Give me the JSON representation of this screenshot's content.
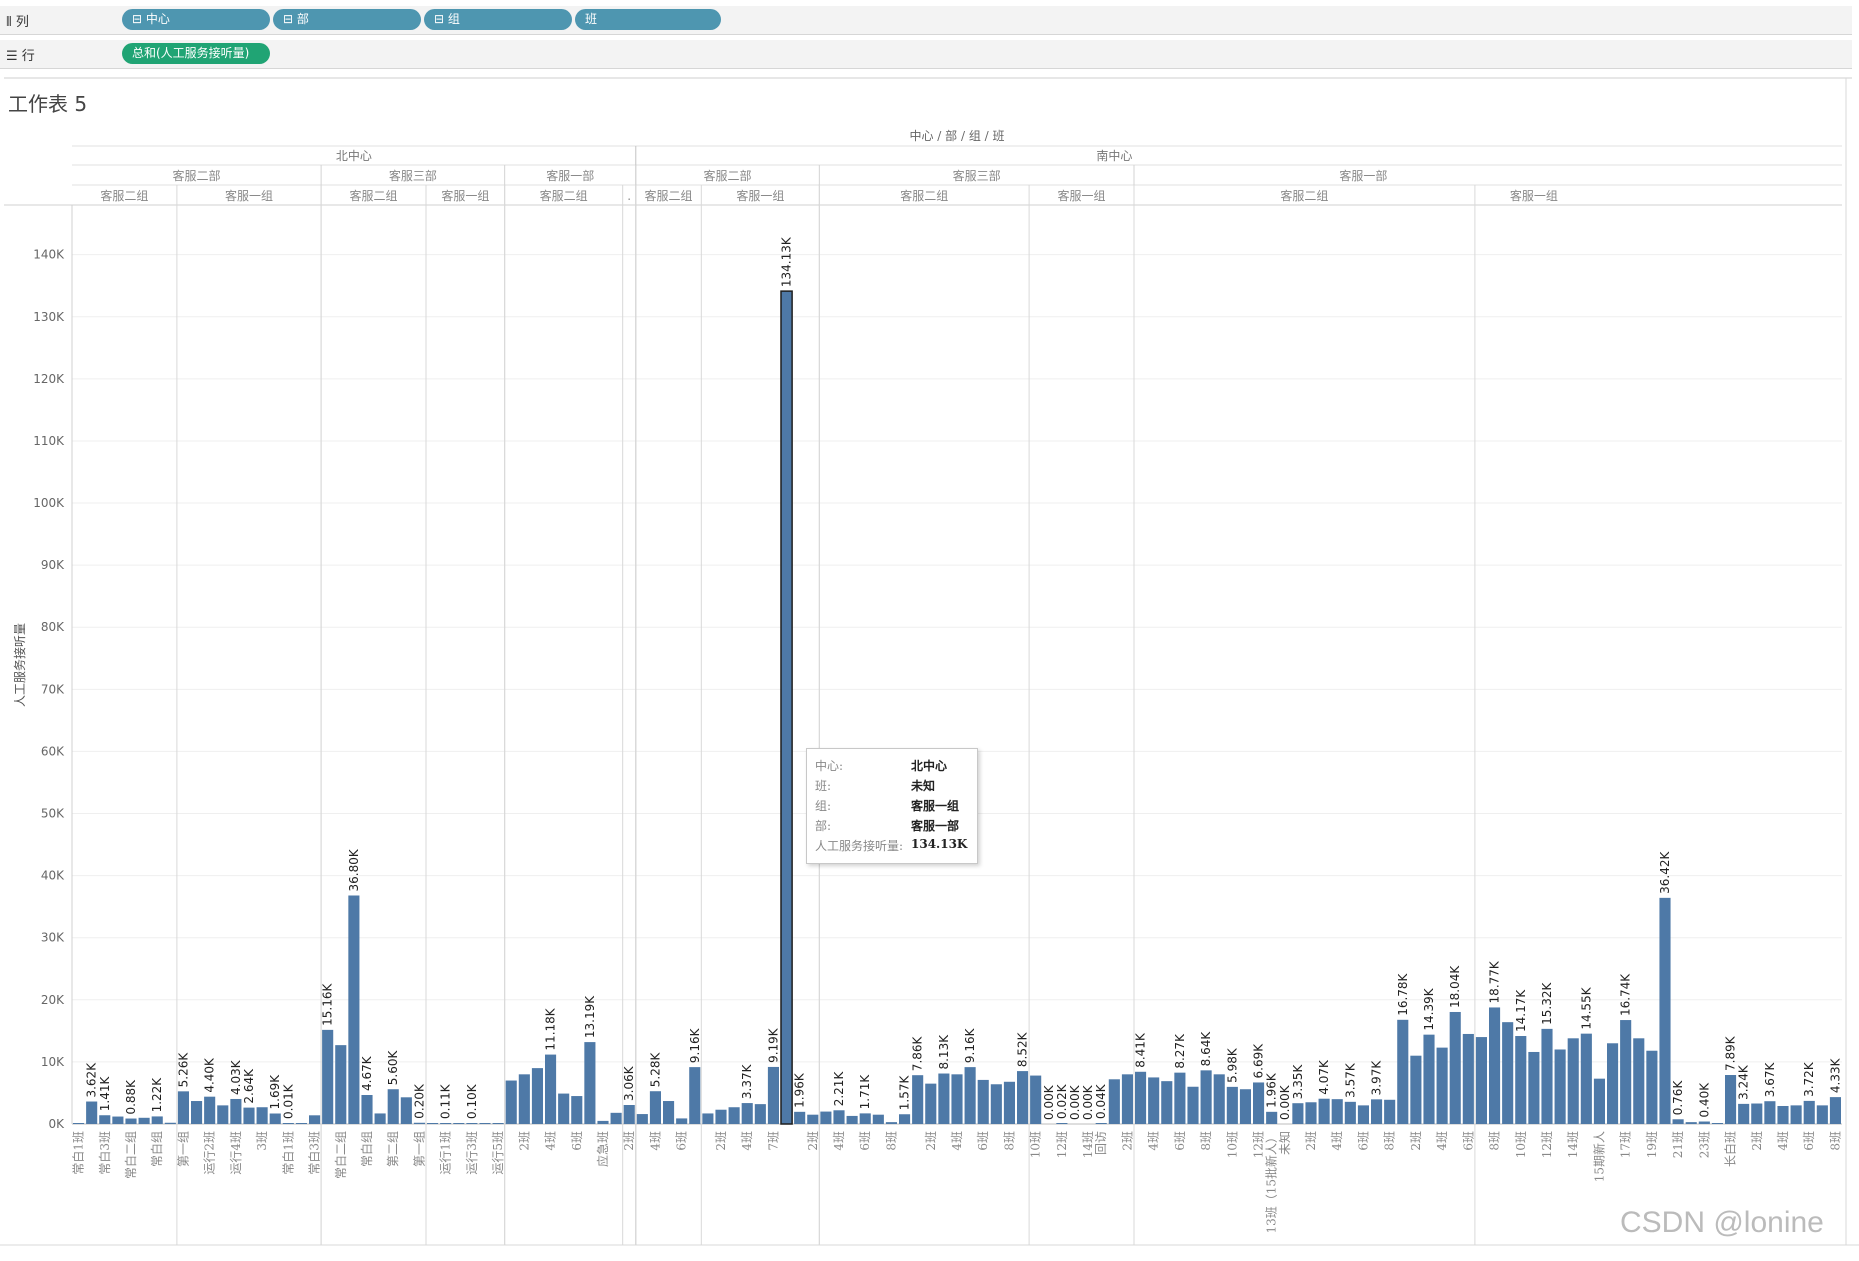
{
  "shelves": {
    "columns_label": "列",
    "columns": [
      "中心",
      "部",
      "组",
      "班"
    ],
    "rows_label": "行",
    "rows": [
      "总和(人工服务接听量)"
    ],
    "collapse_glyph": "⊟"
  },
  "sheet_title": "工作表 5",
  "tooltip": {
    "rows": [
      {
        "key": "中心:",
        "value": "北中心"
      },
      {
        "key": "班:",
        "value": "未知"
      },
      {
        "key": "组:",
        "value": "客服一组"
      },
      {
        "key": "部:",
        "value": "客服一部"
      },
      {
        "key": "人工服务接听量:",
        "value": "134.13K"
      }
    ]
  },
  "watermark": "CSDN @lonine",
  "colors": {
    "bar": "#4e79a7",
    "pill_dim": "#4e96b0",
    "pill_measure": "#20a474"
  },
  "chart_data": {
    "type": "bar",
    "title": "中心 / 部 / 组 / 班",
    "ylabel": "人工服务接听量",
    "ylim": [
      0,
      148000
    ],
    "yticks": [
      0,
      10000,
      20000,
      30000,
      40000,
      50000,
      60000,
      70000,
      80000,
      90000,
      100000,
      110000,
      120000,
      130000,
      140000
    ],
    "ytick_labels": [
      "0K",
      "10K",
      "20K",
      "30K",
      "40K",
      "50K",
      "60K",
      "70K",
      "80K",
      "90K",
      "100K",
      "110K",
      "120K",
      "130K",
      "140K"
    ],
    "headers": {
      "centers": [
        {
          "name": "北中心",
          "span": [
            0,
            43
          ]
        },
        {
          "name": "南中心",
          "span": [
            43,
            116
          ]
        }
      ],
      "departments": [
        {
          "name": "客服二部",
          "span": [
            0,
            19
          ]
        },
        {
          "name": "客服三部",
          "span": [
            19,
            33
          ]
        },
        {
          "name": "客服一部",
          "span": [
            33,
            43
          ]
        },
        {
          "name": "客服二部",
          "span": [
            43,
            57
          ]
        },
        {
          "name": "客服三部",
          "span": [
            57,
            81
          ]
        },
        {
          "name": "客服一部",
          "span": [
            81,
            116
          ]
        }
      ],
      "groups": [
        {
          "name": "客服二组",
          "span": [
            0,
            8
          ]
        },
        {
          "name": "客服一组",
          "span": [
            8,
            19
          ]
        },
        {
          "name": "客服二组",
          "span": [
            19,
            27
          ]
        },
        {
          "name": "客服一组",
          "span": [
            27,
            33
          ]
        },
        {
          "name": "客服二组",
          "span": [
            33,
            42
          ]
        },
        {
          "name": ".",
          "span": [
            42,
            43
          ]
        },
        {
          "name": "客服二组",
          "span": [
            43,
            48
          ]
        },
        {
          "name": "客服一组",
          "span": [
            48,
            57
          ]
        },
        {
          "name": "客服二组",
          "span": [
            57,
            73
          ]
        },
        {
          "name": "客服一组",
          "span": [
            73,
            81
          ]
        },
        {
          "name": "客服二组",
          "span": [
            81,
            107
          ]
        },
        {
          "name": "客服一组",
          "span": [
            107,
            116
          ]
        }
      ]
    },
    "bars": [
      {
        "category": "常白1班",
        "value": 100
      },
      {
        "category": "",
        "value": 3620,
        "label": "3.62K"
      },
      {
        "category": "常白3班",
        "value": 1410,
        "label": "1.41K"
      },
      {
        "category": "",
        "value": 1200
      },
      {
        "category": "常白二组",
        "value": 880,
        "label": "0.88K"
      },
      {
        "category": "",
        "value": 1000
      },
      {
        "category": "常白组",
        "value": 1220,
        "label": "1.22K"
      },
      {
        "category": "",
        "value": 200
      },
      {
        "category": "第一组",
        "value": 5260,
        "label": "5.26K"
      },
      {
        "category": "",
        "value": 3700
      },
      {
        "category": "运行2班",
        "value": 4400,
        "label": "4.40K"
      },
      {
        "category": "",
        "value": 3000
      },
      {
        "category": "运行4班",
        "value": 4030,
        "label": "4.03K"
      },
      {
        "category": "",
        "value": 2640,
        "label": "2.64K"
      },
      {
        "category": "3班",
        "value": 2700
      },
      {
        "category": "",
        "value": 1690,
        "label": "1.69K"
      },
      {
        "category": "常白1班",
        "value": 10,
        "label": "0.01K"
      },
      {
        "category": "",
        "value": 100
      },
      {
        "category": "常白3班",
        "value": 1400
      },
      {
        "category": "",
        "value": 15160,
        "label": "15.16K"
      },
      {
        "category": "常白二组",
        "value": 12700
      },
      {
        "category": "",
        "value": 36800,
        "label": "36.80K"
      },
      {
        "category": "常白组",
        "value": 4670,
        "label": "4.67K"
      },
      {
        "category": "",
        "value": 1700
      },
      {
        "category": "第二组",
        "value": 5600,
        "label": "5.60K"
      },
      {
        "category": "",
        "value": 4300
      },
      {
        "category": "第一组",
        "value": 200,
        "label": "0.20K"
      },
      {
        "category": "",
        "value": 50
      },
      {
        "category": "运行1班",
        "value": 110,
        "label": "0.11K"
      },
      {
        "category": "",
        "value": 50
      },
      {
        "category": "运行3班",
        "value": 100,
        "label": "0.10K"
      },
      {
        "category": "",
        "value": 50
      },
      {
        "category": "运行5班",
        "value": 80
      },
      {
        "category": "",
        "value": 7000
      },
      {
        "category": "2班",
        "value": 8000
      },
      {
        "category": "",
        "value": 9000
      },
      {
        "category": "4班",
        "value": 11180,
        "label": "11.18K"
      },
      {
        "category": "",
        "value": 4900
      },
      {
        "category": "6班",
        "value": 4500
      },
      {
        "category": "",
        "value": 13190,
        "label": "13.19K"
      },
      {
        "category": "应急班",
        "value": 500
      },
      {
        "category": "",
        "value": 1800
      },
      {
        "category": "2班",
        "value": 3060,
        "label": "3.06K"
      },
      {
        "category": "",
        "value": 1600
      },
      {
        "category": "4班",
        "value": 5280,
        "label": "5.28K"
      },
      {
        "category": "",
        "value": 3700
      },
      {
        "category": "6班",
        "value": 900
      },
      {
        "category": "",
        "value": 9160,
        "label": "9.16K"
      },
      {
        "category": "",
        "value": 1700
      },
      {
        "category": "2班",
        "value": 2300
      },
      {
        "category": "",
        "value": 2700
      },
      {
        "category": "4班",
        "value": 3370,
        "label": "3.37K"
      },
      {
        "category": "",
        "value": 3200
      },
      {
        "category": "7班",
        "value": 9190,
        "label": "9.19K"
      },
      {
        "category": "",
        "value": 134130,
        "label": "134.13K"
      },
      {
        "category": "",
        "value": 1960,
        "label": "1.96K"
      },
      {
        "category": "2班",
        "value": 1500
      },
      {
        "category": "",
        "value": 2000
      },
      {
        "category": "4班",
        "value": 2210,
        "label": "2.21K"
      },
      {
        "category": "",
        "value": 1300
      },
      {
        "category": "6班",
        "value": 1710,
        "label": "1.71K"
      },
      {
        "category": "",
        "value": 1500
      },
      {
        "category": "8班",
        "value": 300
      },
      {
        "category": "",
        "value": 1570,
        "label": "1.57K"
      },
      {
        "category": "",
        "value": 7860,
        "label": "7.86K"
      },
      {
        "category": "2班",
        "value": 6500
      },
      {
        "category": "",
        "value": 8130,
        "label": "8.13K"
      },
      {
        "category": "4班",
        "value": 8000
      },
      {
        "category": "",
        "value": 9160,
        "label": "9.16K"
      },
      {
        "category": "6班",
        "value": 7100
      },
      {
        "category": "",
        "value": 6400
      },
      {
        "category": "8班",
        "value": 6800
      },
      {
        "category": "",
        "value": 8520,
        "label": "8.52K"
      },
      {
        "category": "10班",
        "value": 7800
      },
      {
        "category": "",
        "value": 0,
        "label": "0.00K"
      },
      {
        "category": "12班",
        "value": 20,
        "label": "0.02K"
      },
      {
        "category": "",
        "value": 0,
        "label": "0.00K"
      },
      {
        "category": "14班",
        "value": 0,
        "label": "0.00K"
      },
      {
        "category": "回访",
        "value": 40,
        "label": "0.04K"
      },
      {
        "category": "",
        "value": 7200
      },
      {
        "category": "2班",
        "value": 8000
      },
      {
        "category": "",
        "value": 8410,
        "label": "8.41K"
      },
      {
        "category": "4班",
        "value": 7500
      },
      {
        "category": "",
        "value": 6900
      },
      {
        "category": "6班",
        "value": 8270,
        "label": "8.27K"
      },
      {
        "category": "",
        "value": 6000
      },
      {
        "category": "8班",
        "value": 8640,
        "label": "8.64K"
      },
      {
        "category": "",
        "value": 8000
      },
      {
        "category": "10班",
        "value": 5980,
        "label": "5.98K"
      },
      {
        "category": "",
        "value": 5600
      },
      {
        "category": "12班",
        "value": 6690,
        "label": "6.69K"
      },
      {
        "category": "13班（15批新人）",
        "value": 1960,
        "label": "1.96K"
      },
      {
        "category": "未知",
        "value": 0,
        "label": "0.00K"
      },
      {
        "category": "",
        "value": 3350,
        "label": "3.35K"
      },
      {
        "category": "2班",
        "value": 3500
      },
      {
        "category": "",
        "value": 4070,
        "label": "4.07K"
      },
      {
        "category": "4班",
        "value": 4000
      },
      {
        "category": "",
        "value": 3570,
        "label": "3.57K"
      },
      {
        "category": "6班",
        "value": 3000
      },
      {
        "category": "",
        "value": 3970,
        "label": "3.97K"
      },
      {
        "category": "8班",
        "value": 3900
      },
      {
        "category": "",
        "value": 16780,
        "label": "16.78K"
      },
      {
        "category": "2班",
        "value": 11000
      },
      {
        "category": "",
        "value": 14390,
        "label": "14.39K"
      },
      {
        "category": "4班",
        "value": 12300
      },
      {
        "category": "",
        "value": 18040,
        "label": "18.04K"
      },
      {
        "category": "6班",
        "value": 14500
      },
      {
        "category": "",
        "value": 14000
      },
      {
        "category": "8班",
        "value": 18770,
        "label": "18.77K"
      },
      {
        "category": "",
        "value": 16400
      },
      {
        "category": "10班",
        "value": 14170,
        "label": "14.17K"
      },
      {
        "category": "",
        "value": 11600
      },
      {
        "category": "12班",
        "value": 15320,
        "label": "15.32K"
      },
      {
        "category": "",
        "value": 12000
      },
      {
        "category": "14班",
        "value": 13800
      },
      {
        "category": "",
        "value": 14550,
        "label": "14.55K"
      },
      {
        "category": "15期新人",
        "value": 7300
      },
      {
        "category": "",
        "value": 13000
      },
      {
        "category": "17班",
        "value": 16740,
        "label": "16.74K"
      },
      {
        "category": "",
        "value": 13800
      },
      {
        "category": "19班",
        "value": 11800
      },
      {
        "category": "",
        "value": 36420,
        "label": "36.42K"
      },
      {
        "category": "21班",
        "value": 760,
        "label": "0.76K"
      },
      {
        "category": "",
        "value": 300
      },
      {
        "category": "23班",
        "value": 400,
        "label": "0.40K"
      },
      {
        "category": "",
        "value": 100
      },
      {
        "category": "长白班",
        "value": 7890,
        "label": "7.89K"
      },
      {
        "category": "",
        "value": 3240,
        "label": "3.24K"
      },
      {
        "category": "2班",
        "value": 3300
      },
      {
        "category": "",
        "value": 3670,
        "label": "3.67K"
      },
      {
        "category": "4班",
        "value": 2900
      },
      {
        "category": "",
        "value": 3000
      },
      {
        "category": "6班",
        "value": 3720,
        "label": "3.72K"
      },
      {
        "category": "",
        "value": 3000
      },
      {
        "category": "8班",
        "value": 4330,
        "label": "4.33K"
      }
    ],
    "highlighted_bar": 54,
    "grid": "horizontal",
    "legend": "none"
  }
}
